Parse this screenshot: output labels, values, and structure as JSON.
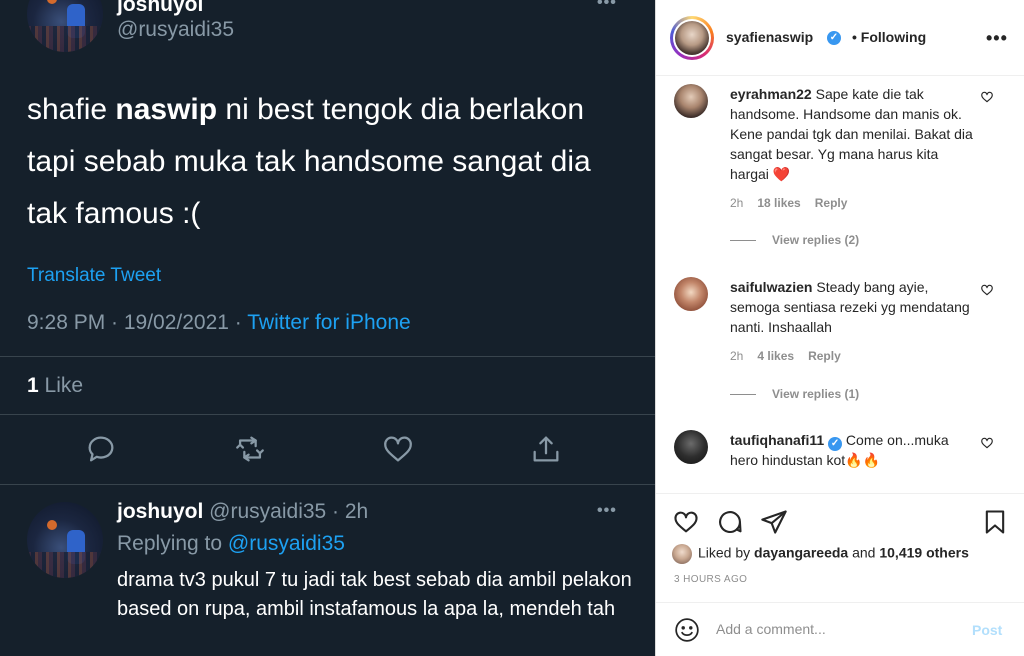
{
  "twitter": {
    "tweet": {
      "name": "joshuyol",
      "handle": "@rusyaidi35",
      "menu": "•••",
      "text_part1": "shafie ",
      "text_bold": "naswip",
      "text_part2": " ni best tengok dia berlakon tapi sebab muka tak handsome sangat dia tak famous :(",
      "translate": "Translate Tweet",
      "time_date": "9:28 PM · 19/02/2021 · ",
      "source": "Twitter for iPhone",
      "likes_count": "1",
      "likes_label": " Like"
    },
    "reply": {
      "name": "joshuyol",
      "handle_time": " @rusyaidi35 · 2h",
      "menu": "•••",
      "replying_label": "Replying to ",
      "replying_to": "@rusyaidi35",
      "text": "drama tv3 pukul 7 tu jadi tak best sebab dia ambil pelakon based on rupa, ambil instafamous la apa la, mendeh tah"
    },
    "icons": [
      "reply-icon",
      "retweet-icon",
      "like-icon",
      "share-icon"
    ]
  },
  "instagram": {
    "header": {
      "username": "syafienaswip",
      "separator": "•",
      "follow_status": "Following",
      "more": "•••"
    },
    "comments": [
      {
        "user": "eyrahman22",
        "text": "Sape kate die tak handsome. Handsome dan manis ok. Kene pandai tgk dan menilai. Bakat dia sangat besar. Yg mana harus kita hargai ❤️",
        "time": "2h",
        "likes": "18 likes",
        "reply": "Reply",
        "view_replies": "View replies (2)"
      },
      {
        "user": "saifulwazien",
        "text": "Steady bang ayie, semoga sentiasa rezeki yg mendatang nanti. Inshaallah",
        "time": "2h",
        "likes": "4 likes",
        "reply": "Reply",
        "view_replies": "View replies (1)"
      },
      {
        "user": "taufiqhanafi11",
        "verified": true,
        "text": "Come on...muka hero hindustan kot🔥🔥"
      }
    ],
    "liked_by_prefix": "Liked by ",
    "liked_by_user": "dayangareeda",
    "liked_by_and": " and ",
    "liked_by_others": "10,419 others",
    "time_ago": "3 HOURS AGO",
    "comment_placeholder": "Add a comment...",
    "post_label": "Post",
    "colors": {
      "verified": "#3897f0",
      "link": "#1da1f2",
      "post_disabled": "#b2dffc"
    }
  }
}
